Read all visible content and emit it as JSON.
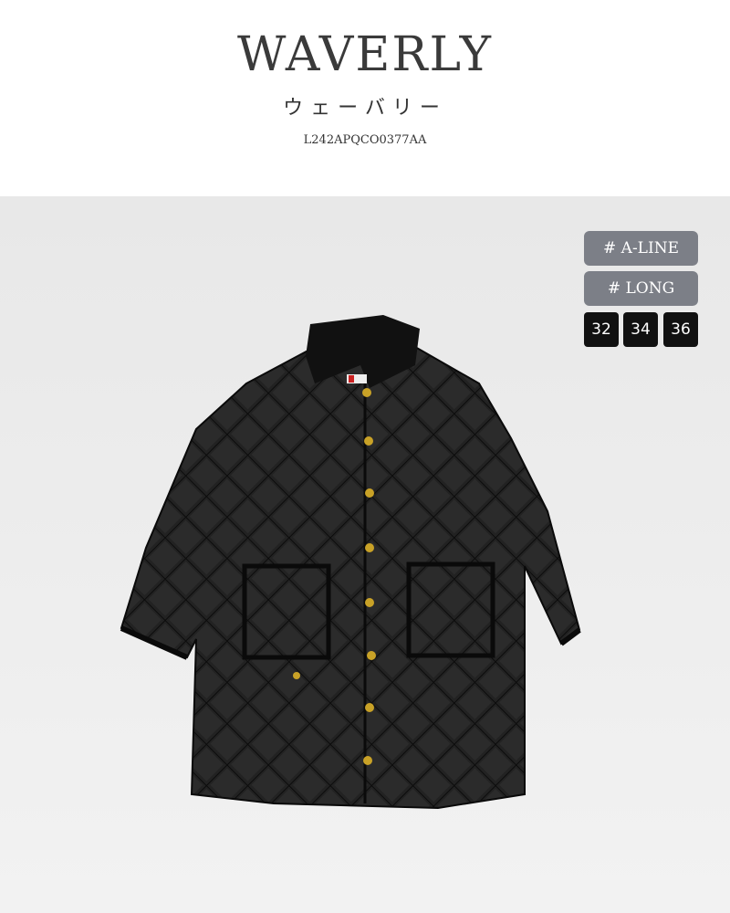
{
  "header": {
    "title": "WAVERLY",
    "subtitle": "ウェーバリー",
    "code": "L242APQCO0377AA"
  },
  "tags": [
    {
      "label": "# A-LINE"
    },
    {
      "label": "# LONG"
    }
  ],
  "sizes": [
    "32",
    "34",
    "36"
  ],
  "colors": {
    "tag_bg": "#7c7f87",
    "size_bg": "#111111",
    "coat": "#1f1f1f",
    "button": "#c9a227"
  }
}
